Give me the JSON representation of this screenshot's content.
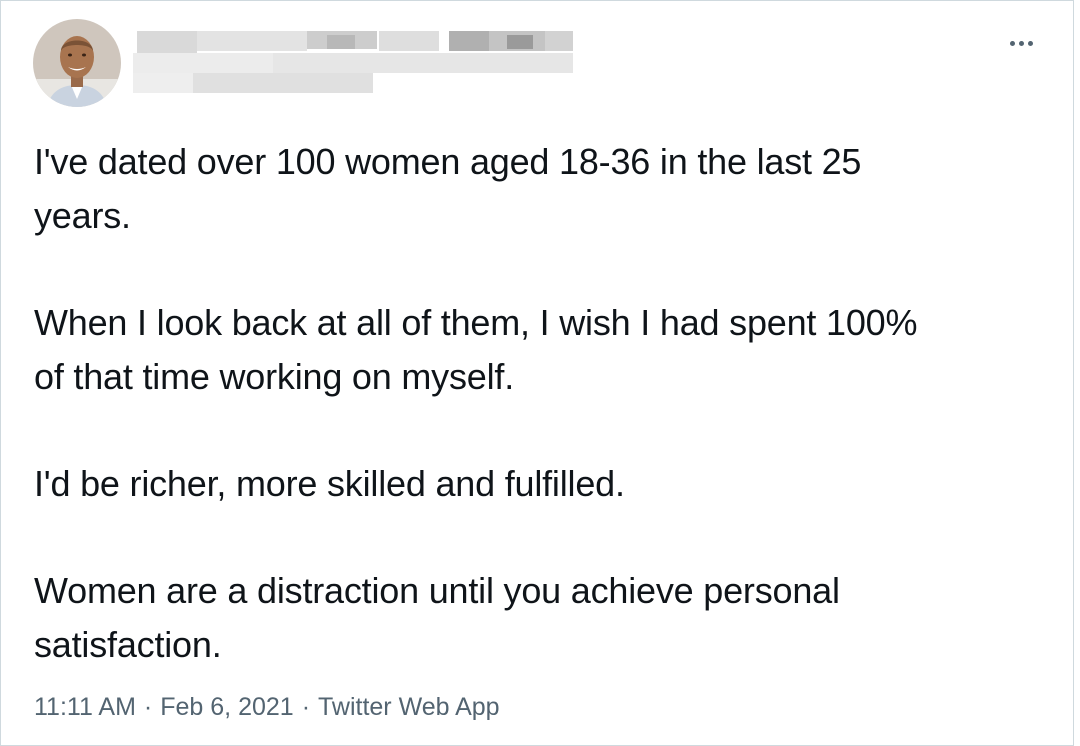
{
  "author": {
    "avatar_icon": "person-photo"
  },
  "tweet": {
    "paragraphs": [
      "I've dated over 100 women aged 18-36 in the last 25\nyears.",
      "When I look back at all of them, I wish I had spent 100%\nof that time working on myself.",
      "I'd be richer, more skilled and fulfilled.",
      "Women are a distraction until you achieve personal\nsatisfaction."
    ],
    "time": "11:11 AM",
    "separator": "·",
    "date": "Feb 6, 2021",
    "source": "Twitter Web App"
  },
  "colors": {
    "text": "#0f1419",
    "meta": "#536471",
    "border": "#cfd9de"
  }
}
